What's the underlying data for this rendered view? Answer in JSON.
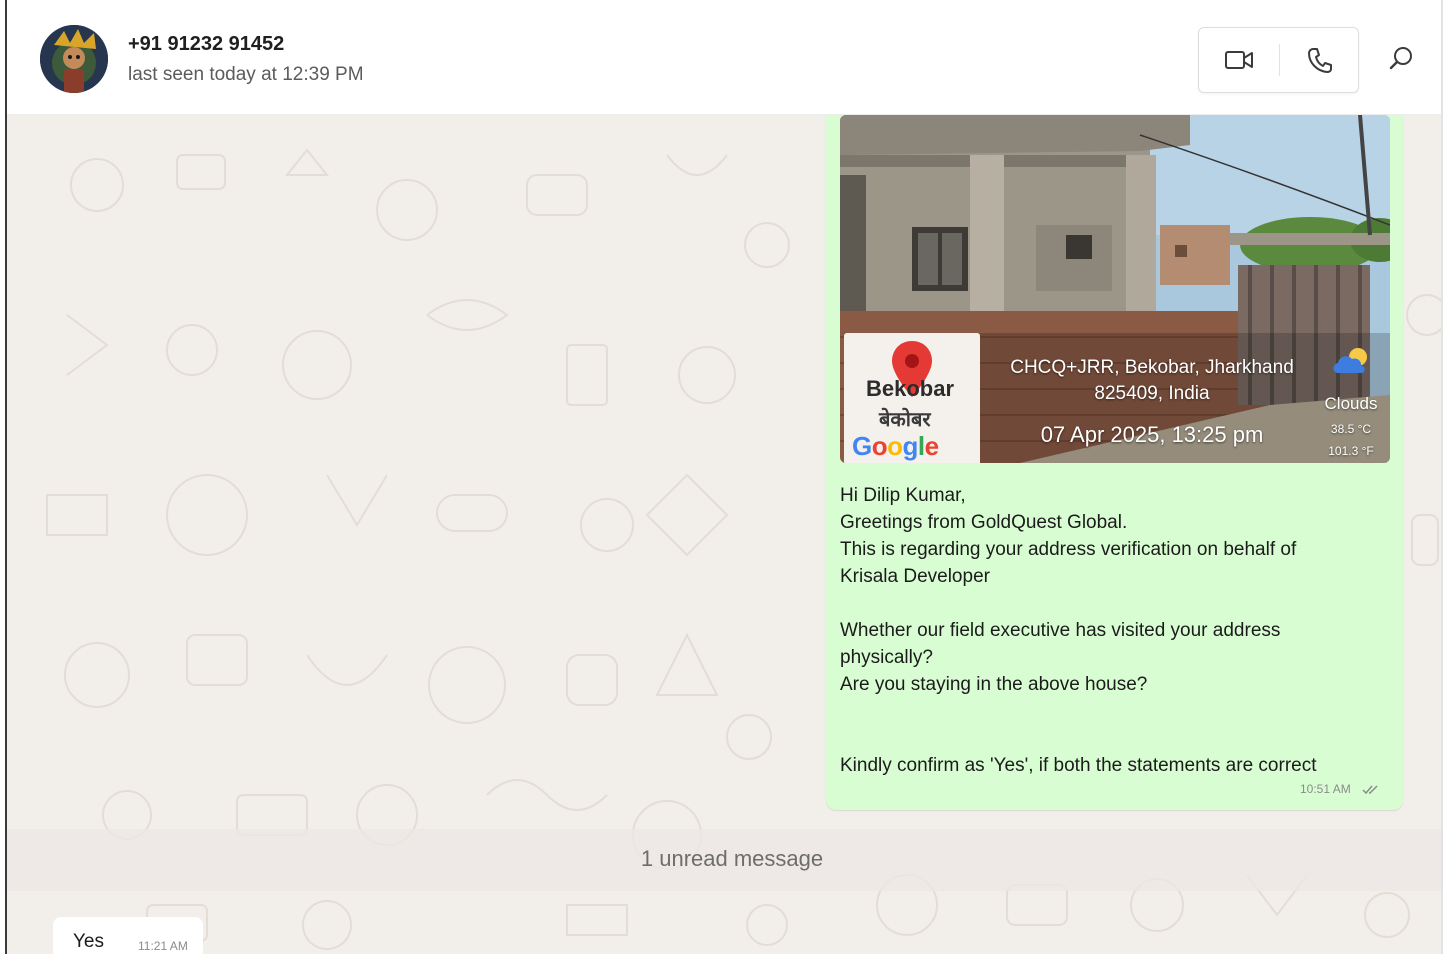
{
  "header": {
    "contact_name": "+91 91232 91452",
    "status": "last seen today at 12:39 PM",
    "icons": [
      "avatar",
      "video-call-icon",
      "voice-call-icon",
      "search-icon"
    ]
  },
  "message_out": {
    "geo_photo": {
      "map_place": "Bekobar",
      "map_place_hindi": "बेकोबर",
      "map_brand": "Google",
      "address_line1": "CHCQ+JRR, Bekobar, Jharkhand",
      "address_line2": "825409, India",
      "datetime": "07 Apr 2025, 13:25 pm",
      "weather_label": "Clouds",
      "temp_c": "38.5 °C",
      "temp_f": "101.3 °F"
    },
    "lines": [
      "Hi Dilip Kumar,",
      "Greetings from GoldQuest Global.",
      "This is regarding your address verification on behalf of",
      "Krisala Developer",
      "Whether our field executive has visited your address",
      "physically?",
      "Are you staying in the above house?",
      "Kindly confirm as 'Yes', if both the statements are correct"
    ],
    "time": "10:51 AM",
    "status_icon": "double-check-icon"
  },
  "unread_banner": "1 unread message",
  "message_in": {
    "text": "Yes",
    "time": "11:21 AM"
  },
  "colors": {
    "outgoing_bubble": "#d9fdd3",
    "chat_background": "#f2eee9",
    "header_background": "#ffffff"
  }
}
